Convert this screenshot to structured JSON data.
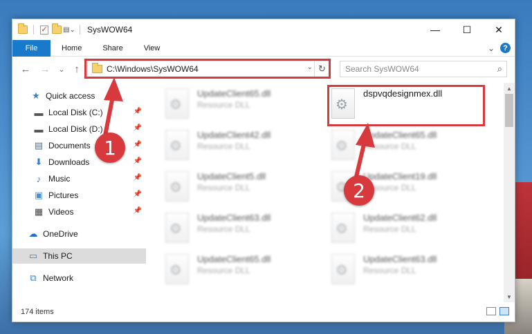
{
  "window": {
    "title": "SysWOW64",
    "controls": {
      "minimize": "—",
      "maximize": "☐",
      "close": "✕"
    }
  },
  "ribbon": {
    "tabs": [
      "File",
      "Home",
      "Share",
      "View"
    ],
    "expand_glyph": "⌄",
    "help_glyph": "?"
  },
  "nav": {
    "back_glyph": "←",
    "forward_glyph": "→",
    "recent_glyph": "⌄",
    "up_glyph": "↑",
    "address": "C:\\Windows\\SysWOW64",
    "address_dropdown_glyph": "⌄",
    "refresh_glyph": "↻",
    "search_placeholder": "Search SysWOW64",
    "search_glyph": "⌕"
  },
  "sidebar": {
    "items": [
      {
        "label": "Quick access",
        "icon": "star-icon",
        "glyph": "★",
        "color": "#3c7fd0",
        "pinned": false
      },
      {
        "label": "Local Disk (C:)",
        "icon": "drive-icon",
        "glyph": "▬",
        "color": "#555555",
        "pinned": true
      },
      {
        "label": "Local Disk (D:)",
        "icon": "drive-icon",
        "glyph": "▬",
        "color": "#555555",
        "pinned": true
      },
      {
        "label": "Documents",
        "icon": "documents-icon",
        "glyph": "▤",
        "color": "#5a6e86",
        "pinned": true
      },
      {
        "label": "Downloads",
        "icon": "downloads-icon",
        "glyph": "⬇",
        "color": "#2f7fd8",
        "pinned": true
      },
      {
        "label": "Music",
        "icon": "music-icon",
        "glyph": "♪",
        "color": "#2f7fd8",
        "pinned": true
      },
      {
        "label": "Pictures",
        "icon": "pictures-icon",
        "glyph": "▣",
        "color": "#4a8fcf",
        "pinned": true
      },
      {
        "label": "Videos",
        "icon": "videos-icon",
        "glyph": "▦",
        "color": "#444444",
        "pinned": true
      },
      {
        "label": "OneDrive",
        "icon": "onedrive-icon",
        "glyph": "☁",
        "color": "#1c6fd1",
        "pinned": false
      },
      {
        "label": "This PC",
        "icon": "computer-icon",
        "glyph": "▭",
        "color": "#2a80d2",
        "pinned": false
      },
      {
        "label": "Network",
        "icon": "network-icon",
        "glyph": "⧉",
        "color": "#2a80d2",
        "pinned": false
      }
    ],
    "pin_glyph": "📌"
  },
  "files": {
    "col1": [
      {
        "name": "UpdateClient65.dll",
        "type": "Resource DLL"
      },
      {
        "name": "UpdateClient42.dll",
        "type": "Resource DLL"
      },
      {
        "name": "UpdateClient5.dll",
        "type": "Resource DLL"
      },
      {
        "name": "UpdateClient63.dll",
        "type": "Resource DLL"
      },
      {
        "name": "UpdateClient65.dll",
        "type": "Resource DLL"
      }
    ],
    "col2": [
      {
        "name": "dspvqdesignmex.dll",
        "type": ""
      },
      {
        "name": "UpdateClient65.dll",
        "type": "Resource DLL"
      },
      {
        "name": "UpdateClient19.dll",
        "type": "Resource DLL"
      },
      {
        "name": "UpdateClient62.dll",
        "type": "Resource DLL"
      },
      {
        "name": "UpdateClient63.dll",
        "type": "Resource DLL"
      }
    ]
  },
  "status": {
    "count": "174 items"
  },
  "annotations": {
    "badge1": "1",
    "badge2": "2",
    "accent": "#d8393d"
  }
}
